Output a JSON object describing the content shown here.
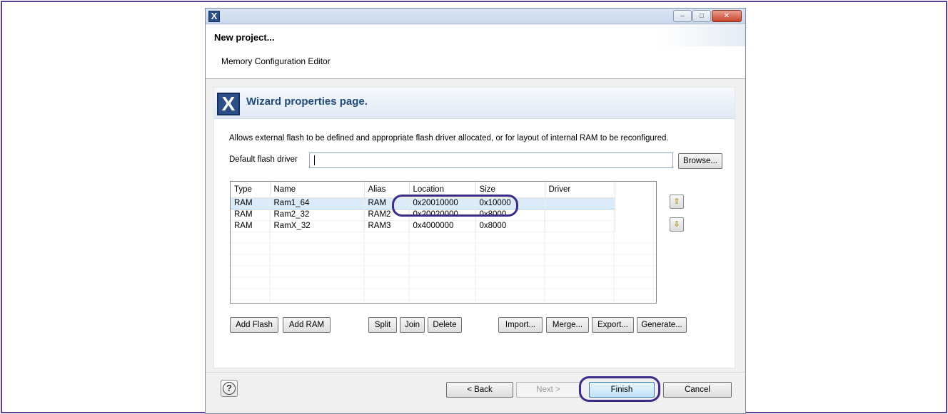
{
  "window": {
    "app_icon": "X",
    "controls": {
      "minimize": "–",
      "maximize": "□",
      "close": "✕"
    }
  },
  "header": {
    "title": "New project...",
    "subtitle": "Memory Configuration Editor"
  },
  "banner": {
    "icon": "X",
    "title": "Wizard properties page."
  },
  "description": "Allows external flash to be defined and appropriate flash driver allocated, or for layout of internal RAM to be reconfigured.",
  "flash_driver": {
    "label": "Default flash driver",
    "value": "",
    "browse_label": "Browse..."
  },
  "table": {
    "columns": [
      "Type",
      "Name",
      "Alias",
      "Location",
      "Size",
      "Driver"
    ],
    "rows": [
      {
        "type": "RAM",
        "name": "Ram1_64",
        "alias": "RAM",
        "location": "0x20010000",
        "size": "0x10000",
        "driver": ""
      },
      {
        "type": "RAM",
        "name": "Ram2_32",
        "alias": "RAM2",
        "location": "0x20020000",
        "size": "0x8000",
        "driver": ""
      },
      {
        "type": "RAM",
        "name": "RamX_32",
        "alias": "RAM3",
        "location": "0x4000000",
        "size": "0x8000",
        "driver": ""
      }
    ],
    "selected_row": 0
  },
  "side_buttons": {
    "up_icon": "⇧",
    "down_icon": "⇩"
  },
  "actions": {
    "add_flash": "Add Flash",
    "add_ram": "Add RAM",
    "split": "Split",
    "join": "Join",
    "delete": "Delete",
    "import": "Import...",
    "merge": "Merge...",
    "export": "Export...",
    "generate": "Generate..."
  },
  "footer": {
    "help": "?",
    "back": "< Back",
    "next": "Next >",
    "finish": "Finish",
    "cancel": "Cancel"
  },
  "colors": {
    "frame": "#5c3d8f",
    "highlight_ring": "#3d2a8a",
    "banner_title": "#1f4a7a"
  }
}
